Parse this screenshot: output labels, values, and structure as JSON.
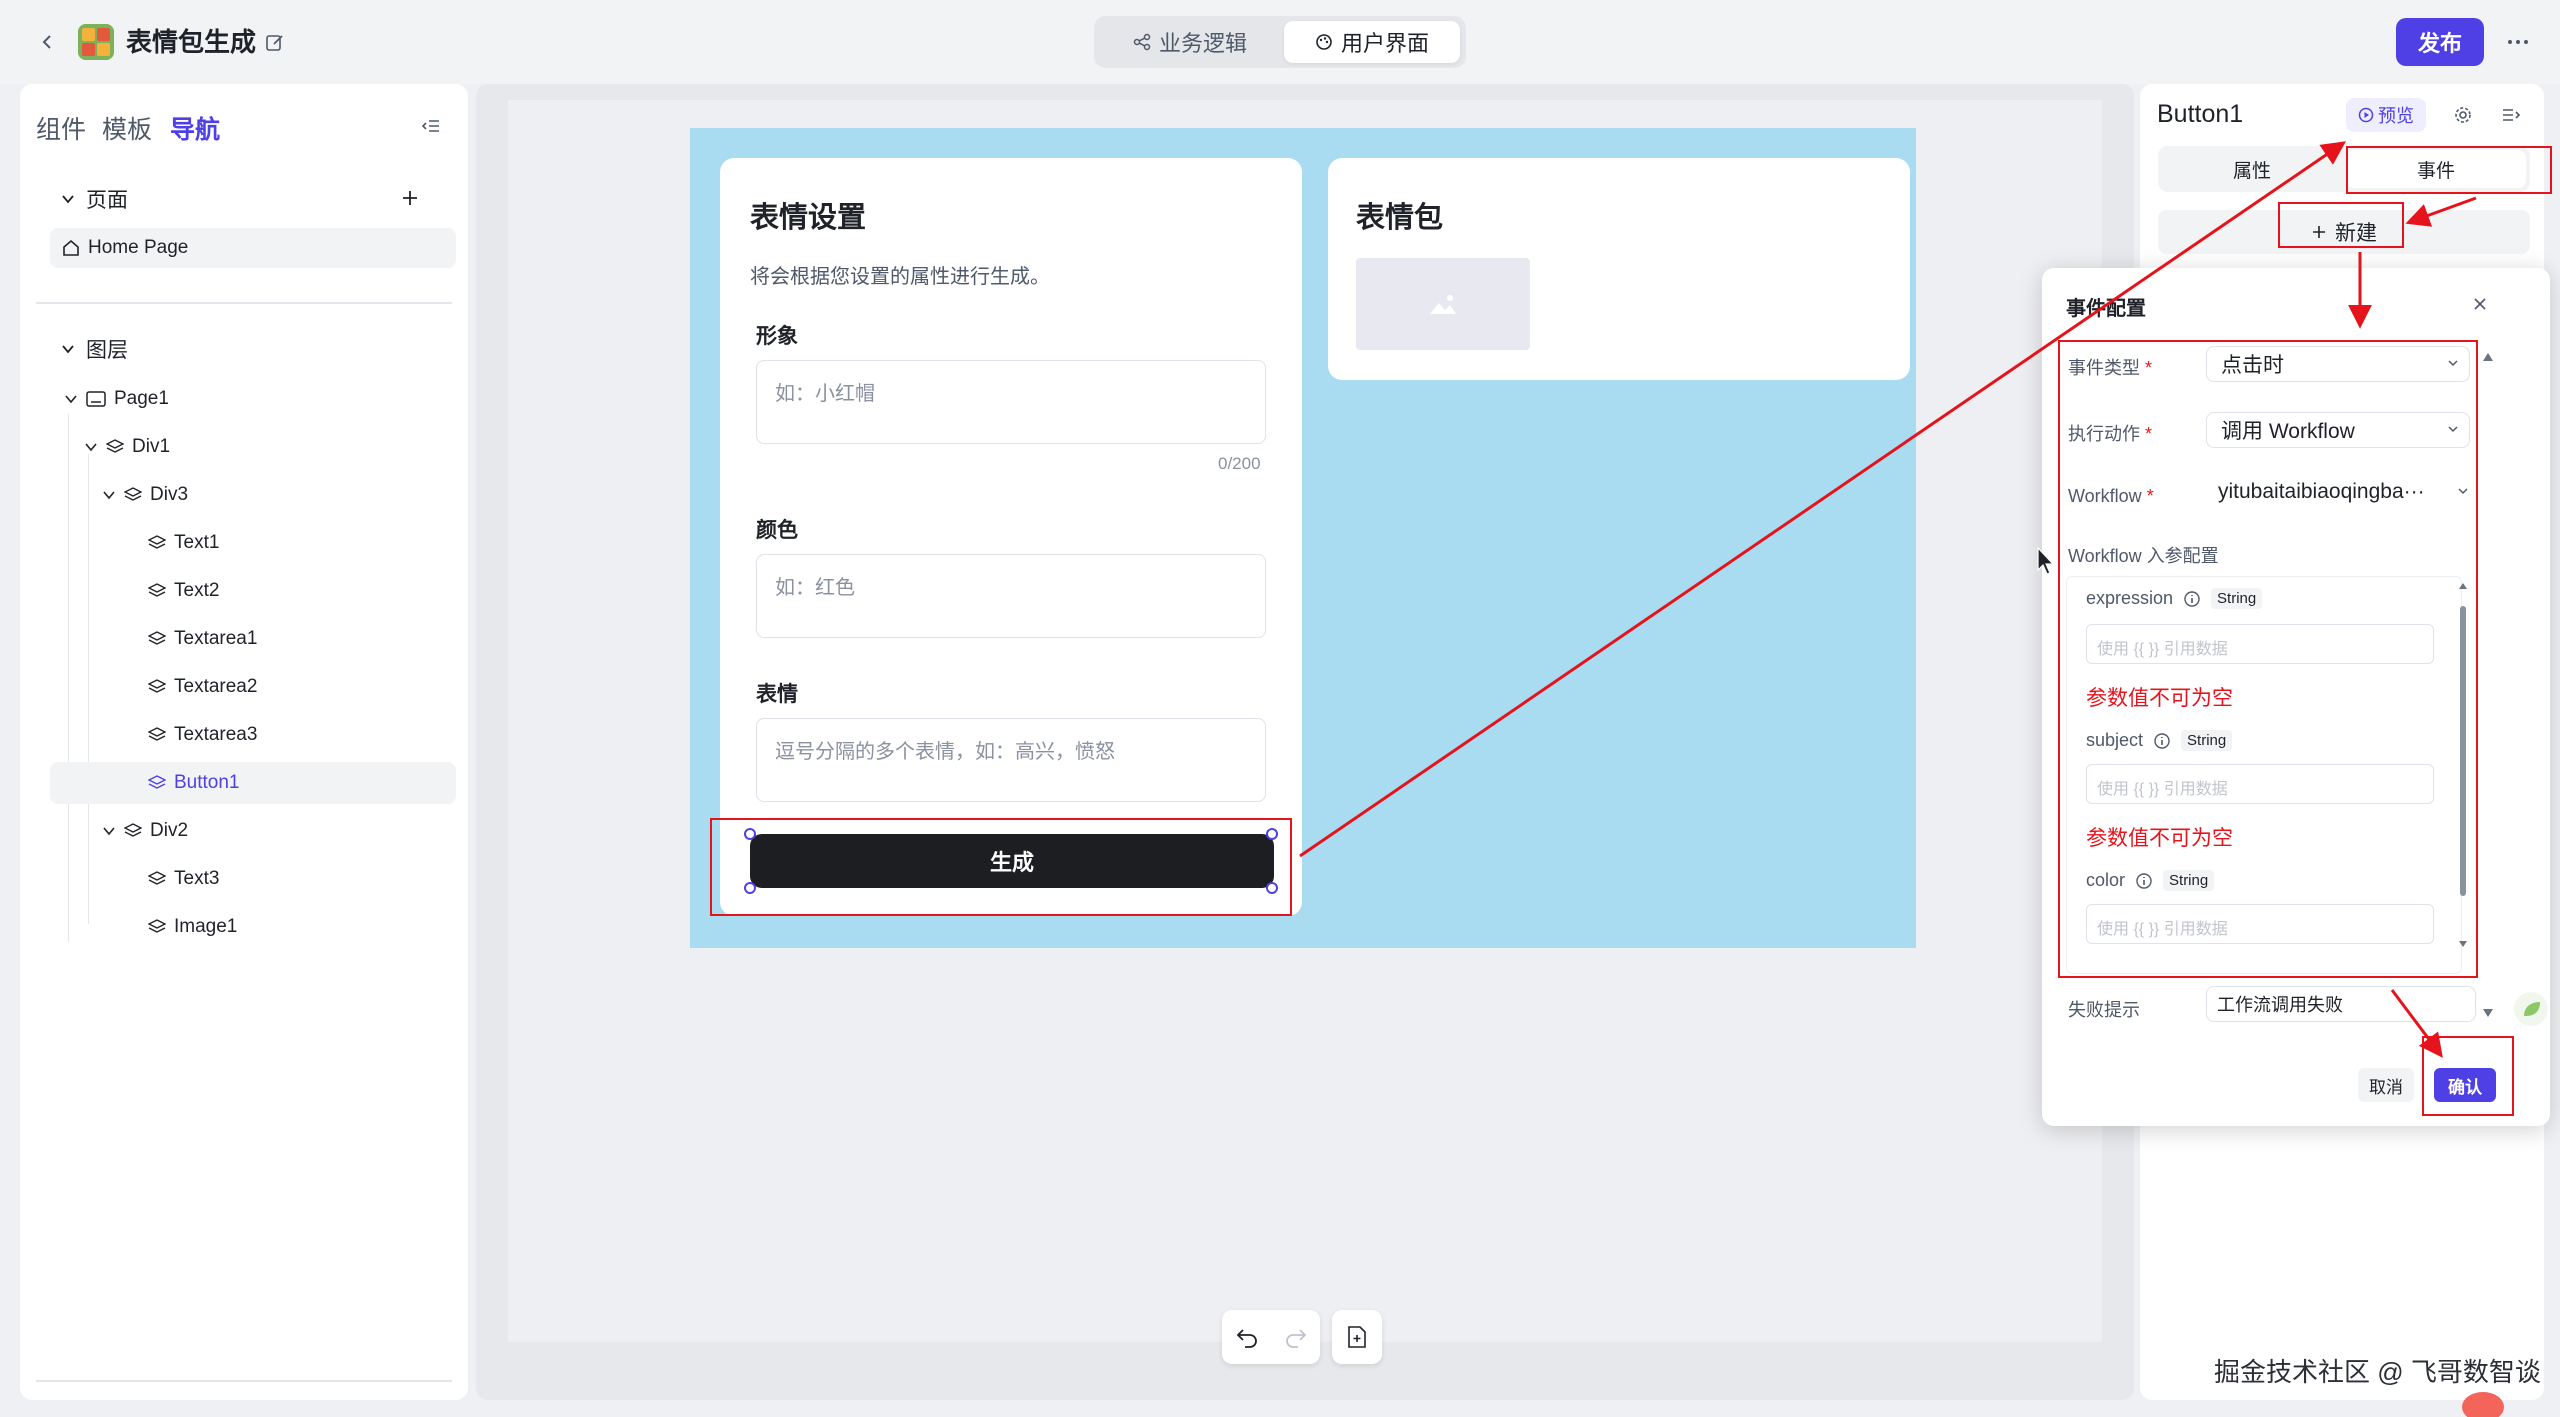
{
  "topbar": {
    "title": "表情包生成",
    "modes": [
      {
        "label": "业务逻辑"
      },
      {
        "label": "用户界面"
      }
    ],
    "publish": "发布"
  },
  "left_panel": {
    "tabs": [
      {
        "label": "组件"
      },
      {
        "label": "模板"
      },
      {
        "label": "导航"
      }
    ],
    "pages_section": "页面",
    "home_page": "Home Page",
    "layers_section": "图层",
    "layers": [
      {
        "label": "Page1"
      },
      {
        "label": "Div1"
      },
      {
        "label": "Div3"
      },
      {
        "label": "Text1"
      },
      {
        "label": "Text2"
      },
      {
        "label": "Textarea1"
      },
      {
        "label": "Textarea2"
      },
      {
        "label": "Textarea3"
      },
      {
        "label": "Button1"
      },
      {
        "label": "Div2"
      },
      {
        "label": "Text3"
      },
      {
        "label": "Image1"
      }
    ]
  },
  "canvas": {
    "form": {
      "title": "表情设置",
      "desc": "将会根据您设置的属性进行生成。",
      "fields": [
        {
          "label": "形象",
          "placeholder": "如：小红帽",
          "counter": "0/200"
        },
        {
          "label": "颜色",
          "placeholder": "如：红色"
        },
        {
          "label": "表情",
          "placeholder": "逗号分隔的多个表情，如：高兴，愤怒"
        }
      ],
      "button": "生成"
    },
    "result": {
      "title": "表情包"
    }
  },
  "right_panel": {
    "component_name": "Button1",
    "preview": "预览",
    "tabs": [
      {
        "label": "属性"
      },
      {
        "label": "事件"
      }
    ],
    "new_button": "新建"
  },
  "dialog": {
    "title": "事件配置",
    "event_type_label": "事件类型",
    "event_type_value": "点击时",
    "action_label": "执行动作",
    "action_value": "调用 Workflow",
    "workflow_label": "Workflow",
    "workflow_value": "yitubaitaibiaoqingba···",
    "params_section": "Workflow 入参配置",
    "params": [
      {
        "name": "expression",
        "type": "String",
        "placeholder": "使用 {{ }} 引用数据",
        "error": "参数值不可为空"
      },
      {
        "name": "subject",
        "type": "String",
        "placeholder": "使用 {{ }} 引用数据",
        "error": "参数值不可为空"
      },
      {
        "name": "color",
        "type": "String",
        "placeholder": "使用 {{ }} 引用数据"
      }
    ],
    "fail_label": "失败提示",
    "fail_value": "工作流调用失败",
    "cancel": "取消",
    "confirm": "确认"
  },
  "watermark": "掘金技术社区 @ 飞哥数智谈",
  "colors": {
    "accent": "#4e40e5",
    "annotation_red": "#e5141c",
    "canvas_blue": "#a9dcf0",
    "button_dark": "#1d1e22"
  }
}
